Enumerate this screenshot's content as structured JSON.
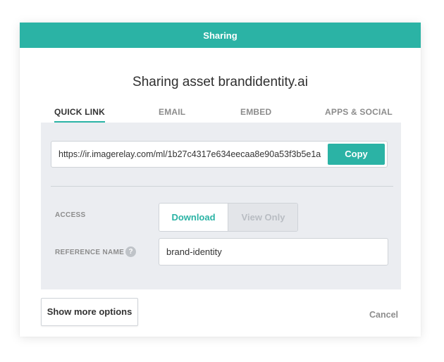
{
  "dialog": {
    "header": "Sharing",
    "title": "Sharing asset brandidentity.ai"
  },
  "tabs": [
    {
      "label": "QUICK LINK",
      "active": true
    },
    {
      "label": "EMAIL",
      "active": false
    },
    {
      "label": "EMBED",
      "active": false
    },
    {
      "label": "APPS & SOCIAL",
      "active": false
    }
  ],
  "quick_link": {
    "url": "https://ir.imagerelay.com/ml/1b27c4317e634eecaa8e90a53f3b5e1a",
    "copy_label": "Copy"
  },
  "access": {
    "label": "ACCESS",
    "options": [
      "Download",
      "View Only"
    ],
    "selected": "Download"
  },
  "reference": {
    "label": "REFERENCE NAME",
    "help_icon": "?",
    "value": "brand-identity"
  },
  "footer": {
    "more_options": "Show more options",
    "cancel": "Cancel"
  },
  "colors": {
    "accent": "#2bb3a5",
    "panel_bg": "#ebedf1"
  },
  "icons": {
    "help": "question-mark-icon"
  }
}
